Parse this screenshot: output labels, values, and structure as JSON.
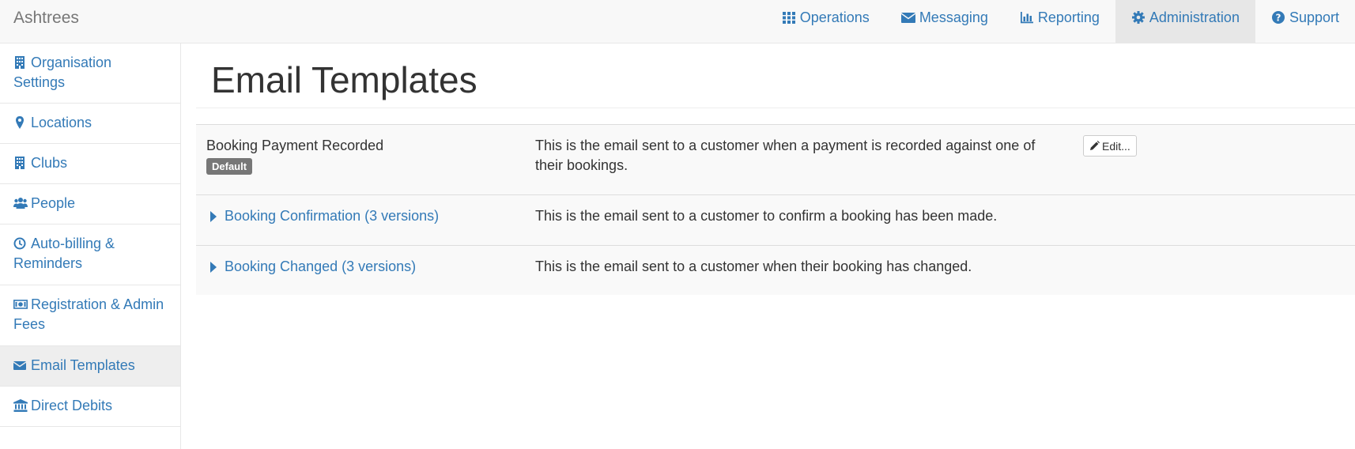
{
  "app": {
    "brand": "Ashtrees"
  },
  "nav": {
    "items": [
      {
        "label": "Operations",
        "icon": "grid-icon"
      },
      {
        "label": "Messaging",
        "icon": "envelope-icon"
      },
      {
        "label": "Reporting",
        "icon": "bar-chart-icon"
      },
      {
        "label": "Administration",
        "icon": "gear-icon",
        "active": true
      },
      {
        "label": "Support",
        "icon": "question-circle-icon"
      }
    ]
  },
  "sidebar": {
    "items": [
      {
        "label": "Organisation Settings",
        "icon": "building-icon"
      },
      {
        "label": "Locations",
        "icon": "map-marker-icon"
      },
      {
        "label": "Clubs",
        "icon": "building-icon"
      },
      {
        "label": "People",
        "icon": "users-icon"
      },
      {
        "label": "Auto-billing & Reminders",
        "icon": "clock-icon"
      },
      {
        "label": "Registration & Admin Fees",
        "icon": "money-icon"
      },
      {
        "label": "Email Templates",
        "icon": "envelope-icon",
        "active": true
      },
      {
        "label": "Direct Debits",
        "icon": "bank-icon"
      }
    ]
  },
  "page": {
    "title": "Email Templates"
  },
  "templates": {
    "rows": [
      {
        "name": "Booking Payment Recorded",
        "badge": "Default",
        "description": "This is the email sent to a customer when a payment is recorded against one of their bookings.",
        "action": "Edit..."
      },
      {
        "name": "Booking Confirmation (3 versions)",
        "description": "This is the email sent to a customer to confirm a booking has been made."
      },
      {
        "name": "Booking Changed (3 versions)",
        "description": "This is the email sent to a customer when their booking has changed."
      }
    ]
  },
  "colors": {
    "link": "#337ab7",
    "navbar_bg": "#f8f8f8",
    "active_bg": "#e7e7e7",
    "badge_bg": "#777777",
    "table_bg": "#f9f9f9"
  }
}
